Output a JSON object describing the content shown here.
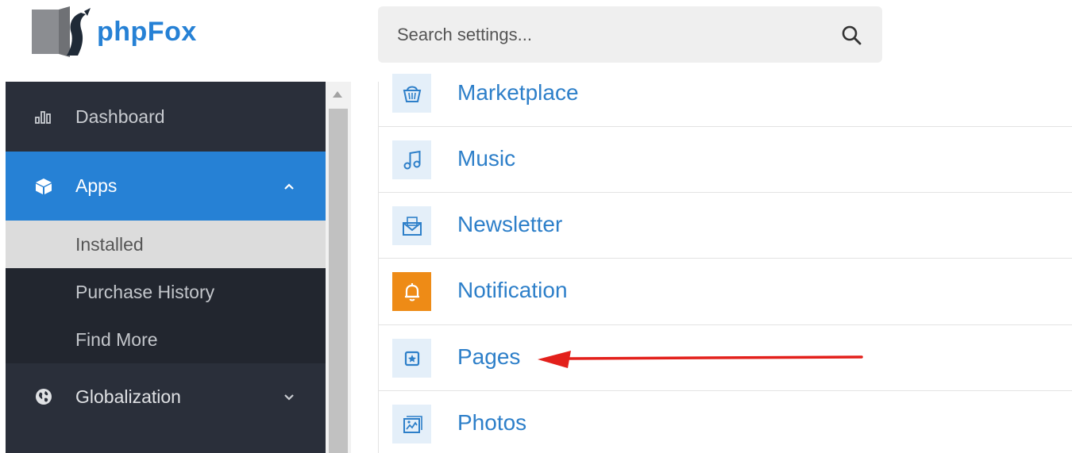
{
  "brand": {
    "name": "phpFox"
  },
  "search": {
    "placeholder": "Search settings..."
  },
  "sidebar": {
    "items": [
      {
        "label": "Dashboard",
        "icon": "bar-chart-icon"
      },
      {
        "label": "Apps",
        "icon": "cube-icon",
        "expanded": true,
        "active": true
      },
      {
        "label": "Globalization",
        "icon": "globe-icon",
        "expanded": false
      }
    ],
    "apps_submenu": [
      {
        "label": "Installed",
        "selected": true
      },
      {
        "label": "Purchase History"
      },
      {
        "label": "Find More"
      }
    ]
  },
  "apps_list": [
    {
      "label": "Marketplace",
      "icon": "basket-icon"
    },
    {
      "label": "Music",
      "icon": "music-note-icon"
    },
    {
      "label": "Newsletter",
      "icon": "envelope-icon"
    },
    {
      "label": "Notification",
      "icon": "bell-icon"
    },
    {
      "label": "Pages",
      "icon": "page-star-icon"
    },
    {
      "label": "Photos",
      "icon": "photo-icon"
    }
  ],
  "colors": {
    "accent": "#2681d5",
    "sidebar_bg": "#2a2f3a",
    "link": "#2d7fc9",
    "notification_icon_bg": "#ee8b16",
    "annotation_arrow": "#e3201b"
  }
}
